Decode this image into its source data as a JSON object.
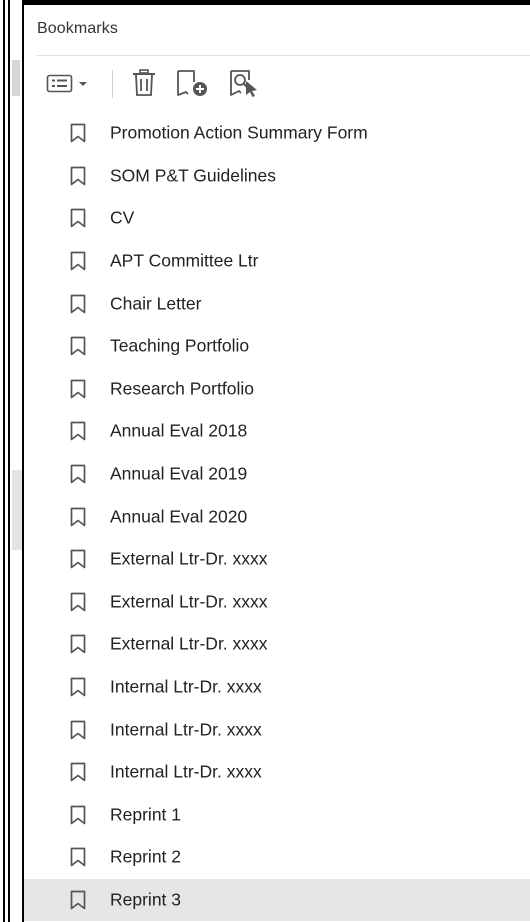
{
  "panel": {
    "title": "Bookmarks"
  },
  "toolbar": {
    "options_icon": "bookmark-options-icon",
    "delete_icon": "trash-icon",
    "new_icon": "new-bookmark-icon",
    "search_icon": "search-bookmark-icon"
  },
  "bookmarks": [
    {
      "label": "Promotion Action Summary Form"
    },
    {
      "label": "SOM P&T Guidelines"
    },
    {
      "label": "CV"
    },
    {
      "label": "APT Committee Ltr"
    },
    {
      "label": "Chair Letter"
    },
    {
      "label": "Teaching Portfolio"
    },
    {
      "label": "Research Portfolio"
    },
    {
      "label": "Annual Eval 2018"
    },
    {
      "label": "Annual Eval 2019"
    },
    {
      "label": "Annual Eval 2020"
    },
    {
      "label": "External Ltr-Dr. xxxx"
    },
    {
      "label": "External Ltr-Dr. xxxx"
    },
    {
      "label": "External Ltr-Dr. xxxx"
    },
    {
      "label": "Internal Ltr-Dr. xxxx"
    },
    {
      "label": "Internal Ltr-Dr. xxxx"
    },
    {
      "label": "Internal Ltr-Dr. xxxx"
    },
    {
      "label": "Reprint 1"
    },
    {
      "label": "Reprint 2"
    },
    {
      "label": "Reprint 3",
      "selected": true
    }
  ],
  "colors": {
    "selected_row": "#e6e6e6",
    "icon_stroke": "#555555",
    "text": "#222222"
  }
}
